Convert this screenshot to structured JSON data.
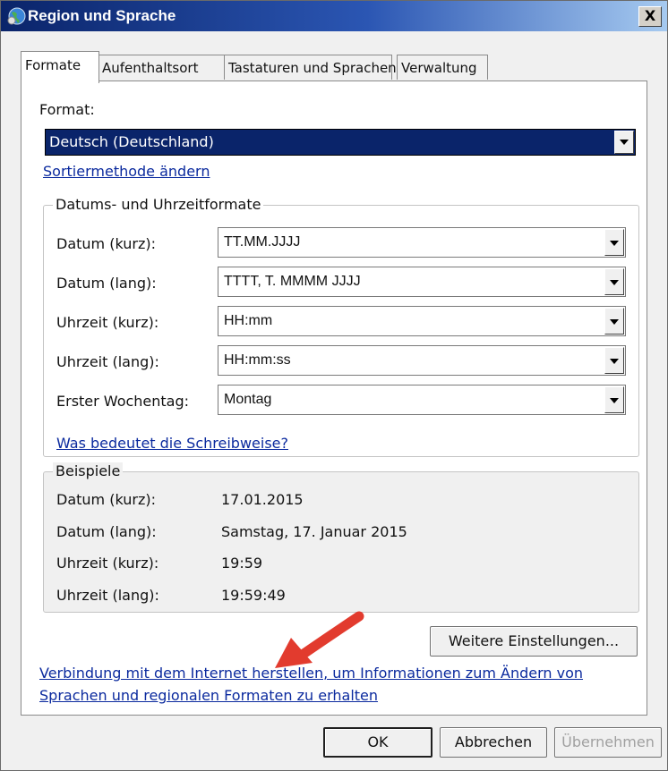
{
  "window": {
    "title": "Region und Sprache",
    "close_label": "X"
  },
  "tabs": [
    {
      "label": "Formate",
      "active": true
    },
    {
      "label": "Aufenthaltsort",
      "active": false
    },
    {
      "label": "Tastaturen und Sprachen",
      "active": false
    },
    {
      "label": "Verwaltung",
      "active": false
    }
  ],
  "format": {
    "label": "Format:",
    "selected": "Deutsch (Deutschland)",
    "sort_link": "Sortiermethode ändern"
  },
  "date_time_group": {
    "title": "Datums- und Uhrzeitformate",
    "rows": [
      {
        "label": "Datum (kurz):",
        "value": "TT.MM.JJJJ"
      },
      {
        "label": "Datum (lang):",
        "value": "TTTT, T. MMMM JJJJ"
      },
      {
        "label": "Uhrzeit (kurz):",
        "value": "HH:mm"
      },
      {
        "label": "Uhrzeit (lang):",
        "value": "HH:mm:ss"
      },
      {
        "label": "Erster Wochentag:",
        "value": "Montag"
      }
    ],
    "help_link": "Was bedeutet die Schreibweise?"
  },
  "examples": {
    "title": "Beispiele",
    "rows": [
      {
        "label": "Datum (kurz):",
        "value": "17.01.2015"
      },
      {
        "label": "Datum (lang):",
        "value": "Samstag, 17. Januar 2015"
      },
      {
        "label": "Uhrzeit (kurz):",
        "value": "19:59"
      },
      {
        "label": "Uhrzeit (lang):",
        "value": "19:59:49"
      }
    ]
  },
  "more_settings_button": "Weitere Einstellungen...",
  "internet_link": {
    "line1": "Verbindung mit dem Internet herstellen, um Informationen zum Ändern von",
    "line2": "Sprachen und regionalen Formaten zu erhalten"
  },
  "footer": {
    "ok": "OK",
    "cancel": "Abbrechen",
    "apply": "Übernehmen"
  },
  "colors": {
    "accent_red_arrow": "#e23b2e",
    "link": "#0b2a9e",
    "selection": "#0a246a"
  }
}
